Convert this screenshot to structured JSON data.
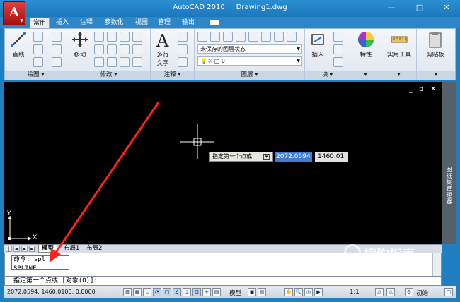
{
  "titlebar": {
    "app_name": "AutoCAD 2010",
    "document": "Drawing1.dwg",
    "app_button_letter": "A",
    "minimize": "—",
    "maximize": "□",
    "close": "✕"
  },
  "ribbon_tabs": [
    "常用",
    "插入",
    "注释",
    "参数化",
    "视图",
    "管理",
    "输出"
  ],
  "ribbon": {
    "draw": {
      "title": "绘图 ▾",
      "line_label": "直线"
    },
    "modify": {
      "title": "修改 ▾",
      "move_label": "移动"
    },
    "annotation": {
      "title": "注释 ▾",
      "mtext_label": "多行\n文字",
      "mtext_line1": "多行",
      "mtext_line2": "文字"
    },
    "layers": {
      "title": "图层 ▾",
      "layer_state": "未保存的图层状态",
      "current_layer": "0"
    },
    "block": {
      "title": "块 ▾",
      "insert_label": "插入"
    },
    "properties": {
      "label": "特性"
    },
    "utilities": {
      "label": "实用工具"
    },
    "clipboard": {
      "label": "剪贴板"
    }
  },
  "viewport": {
    "controls": [
      "_",
      "▫",
      "✕"
    ],
    "tooltip": "指定第一个点或",
    "coord_x": "2072.0594",
    "coord_y": "1460.01",
    "ucs_x": "X",
    "ucs_y": "Y",
    "tool_palette": "图纸集管理器"
  },
  "layout_tabs": [
    "模型",
    "布局1",
    "布局2"
  ],
  "command": {
    "line1": "命令: spl",
    "line2": "SPLINE",
    "prompt": "指定第一个点或 [对象(O)]:"
  },
  "statusbar": {
    "coords": "2072.0594,  1460.0100,  0.0000",
    "model": "模型",
    "scale": "1:1",
    "workspace": "初始"
  },
  "watermark": {
    "main": "搜狗指南",
    "sub": "zhinan.sogou.com"
  },
  "colors": {
    "title_blue": "#1b78bb",
    "drawing_bg": "#000000",
    "annotation_arrow": "#ff2020",
    "crosshair": "#ffffff"
  }
}
